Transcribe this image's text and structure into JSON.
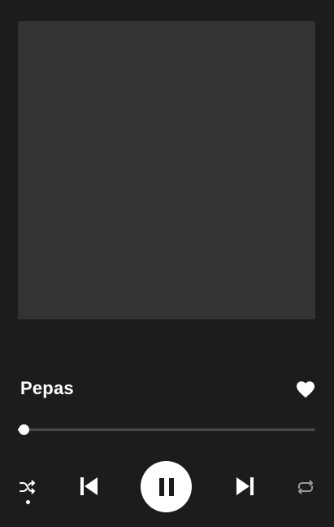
{
  "track": {
    "title": "Pepas",
    "liked": true,
    "progress_fraction": 0.02
  },
  "controls": {
    "shuffle": {
      "icon": "shuffle-icon",
      "active": true
    },
    "previous": {
      "icon": "skip-previous-icon"
    },
    "play_pause": {
      "icon": "pause-icon",
      "state": "playing"
    },
    "next": {
      "icon": "skip-next-icon"
    },
    "repeat": {
      "icon": "repeat-icon",
      "active": false
    }
  },
  "colors": {
    "background": "#1c1c1c",
    "artwork_placeholder": "#333333",
    "accent": "#ffffff",
    "inactive_icon": "#9a9a9a",
    "track_bar": "#4a4a4a"
  }
}
